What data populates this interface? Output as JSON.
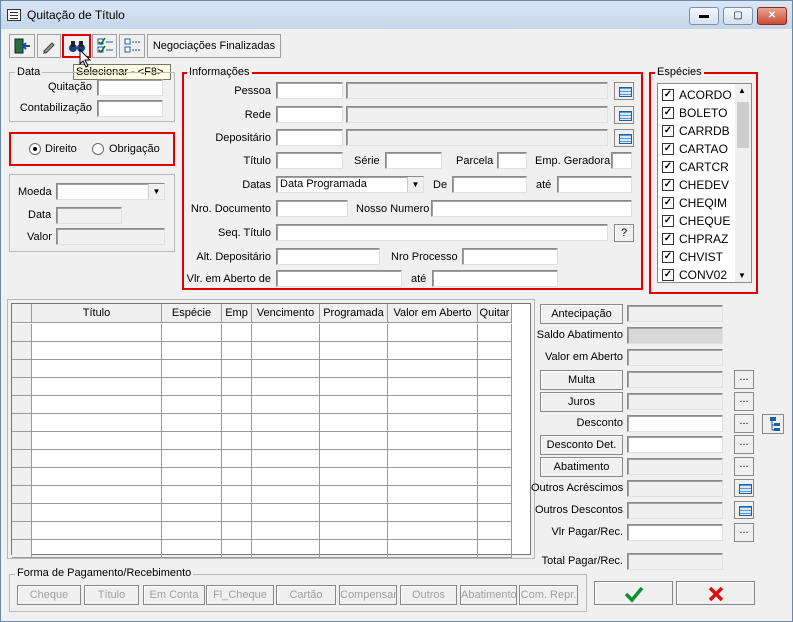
{
  "window": {
    "title": "Quitação de Título",
    "min": "▬",
    "max": "▢",
    "close": "✕"
  },
  "toolbar": {
    "negociacoes_label": "Negociações Finalizadas",
    "tooltip": "Selecionar - <F8>"
  },
  "data_group": {
    "legend": "Data",
    "quitacao_label": "Quitação",
    "contabilizacao_label": "Contabilização"
  },
  "tipo": {
    "direito_label": "Direito",
    "obrigacao_label": "Obrigação",
    "selected": "Direito"
  },
  "moeda_group": {
    "moeda_label": "Moeda",
    "data_label": "Data",
    "valor_label": "Valor"
  },
  "informacoes": {
    "legend": "Informações",
    "pessoa_label": "Pessoa",
    "rede_label": "Rede",
    "depositario_label": "Depositário",
    "titulo_label": "Título",
    "serie_label": "Série",
    "parcela_label": "Parcela",
    "emp_label": "Emp. Geradora",
    "datas_label": "Datas",
    "datas_value": "Data Programada",
    "de_label": "De",
    "ate_label": "até",
    "nro_doc_label": "Nro. Documento",
    "nosso_numero_label": "Nosso Numero",
    "seq_titulo_label": "Seq. Título",
    "seq_btn": "?",
    "alt_dep_label": "Alt. Depositário",
    "nro_processo_label": "Nro Processo",
    "vlr_aberto_label": "Vlr. em Aberto de",
    "vlr_ate_label": "até"
  },
  "especies": {
    "legend": "Espécies",
    "items": [
      "ACORDO",
      "BOLETO",
      "CARRDB",
      "CARTAO",
      "CARTCR",
      "CHEDEV",
      "CHEQIM",
      "CHEQUE",
      "CHPRAZ",
      "CHVIST",
      "CONV02"
    ]
  },
  "grid": {
    "columns": [
      "Título",
      "Espécie",
      "Emp",
      "Vencimento",
      "Programada",
      "Valor em Aberto",
      "Quitar"
    ]
  },
  "valores": {
    "antecipacao": "Antecipação",
    "saldo_abatimento": "Saldo Abatimento",
    "valor_aberto": "Valor em Aberto",
    "multa": "Multa",
    "juros": "Juros",
    "desconto": "Desconto",
    "desconto_det": "Desconto Det.",
    "abatimento": "Abatimento",
    "outros_acrescimos": "Outros Acréscimos",
    "outros_descontos": "Outros Descontos",
    "vlr_pagar": "Vlr Pagar/Rec.",
    "total_pagar": "Total Pagar/Rec.",
    "dots": "..."
  },
  "pagamento": {
    "legend": "Forma de Pagamento/Recebimento",
    "buttons": [
      "Cheque",
      "Título",
      "Em Conta",
      "Fl_Cheque",
      "Cartão",
      "Compensar",
      "Outros",
      "Abatimento",
      "Com. Repr."
    ]
  },
  "actions": {
    "confirm": "✔",
    "cancel": "✖"
  }
}
